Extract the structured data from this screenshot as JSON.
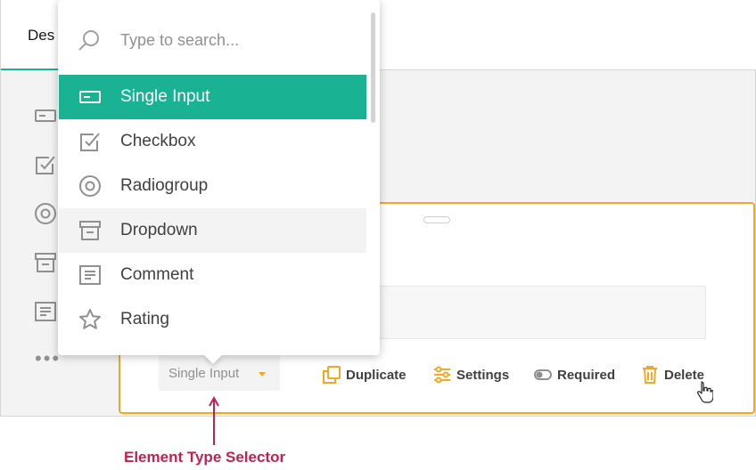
{
  "header": {
    "designer_tab_label": "Des"
  },
  "toolbox": {
    "icons": [
      "single-input-icon",
      "checkbox-icon",
      "radiogroup-icon",
      "dropdown-icon",
      "comment-icon"
    ],
    "more_label": "•••"
  },
  "dropdown": {
    "search_placeholder": "Type to search...",
    "search_value": "",
    "items": [
      {
        "label": "Single Input",
        "icon": "single-input-icon",
        "state": "selected"
      },
      {
        "label": "Checkbox",
        "icon": "checkbox-icon",
        "state": "normal"
      },
      {
        "label": "Radiogroup",
        "icon": "radiogroup-icon",
        "state": "normal"
      },
      {
        "label": "Dropdown",
        "icon": "dropdown-icon",
        "state": "hovered"
      },
      {
        "label": "Comment",
        "icon": "comment-icon",
        "state": "normal"
      },
      {
        "label": "Rating",
        "icon": "rating-icon",
        "state": "normal"
      }
    ]
  },
  "question": {
    "type_selector_label": "Single Input",
    "actions": {
      "duplicate": "Duplicate",
      "settings": "Settings",
      "required": "Required",
      "delete": "Delete"
    }
  },
  "annotation": {
    "label": "Element Type Selector"
  },
  "colors": {
    "accent": "#19b394",
    "selection_border": "#f7a623",
    "annotation": "#c0214f",
    "icon_gray": "#909090"
  }
}
